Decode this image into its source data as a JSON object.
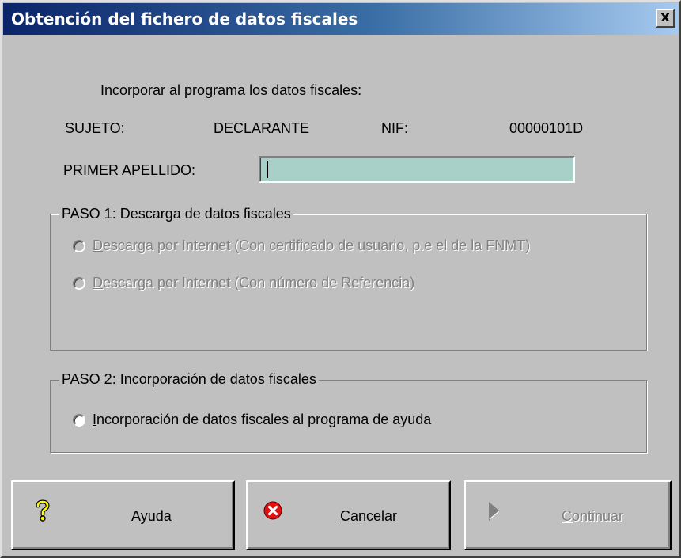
{
  "window": {
    "title": "Obtención del fichero de datos fiscales",
    "close_glyph": "x"
  },
  "intro": {
    "text": "Incorporar al programa los datos fiscales:"
  },
  "subject": {
    "sujeto_label": "SUJETO:",
    "sujeto_value": "DECLARANTE",
    "nif_label": "NIF:",
    "nif_value": "00000101D"
  },
  "apellido": {
    "label": "PRIMER APELLIDO:",
    "value": ""
  },
  "paso1": {
    "legend": "PASO 1: Descarga de datos fiscales",
    "options": [
      {
        "accel": "D",
        "rest": "escarga por Internet (Con certificado  de usuario, p.e el de la FNMT)",
        "enabled": false
      },
      {
        "accel": "D",
        "rest": "escarga por Internet (Con número de Referencia)",
        "enabled": false
      }
    ]
  },
  "paso2": {
    "legend": "PASO 2: Incorporación de datos fiscales",
    "options": [
      {
        "accel": "I",
        "rest": "ncorporación de datos fiscales al programa de ayuda",
        "enabled": true
      }
    ]
  },
  "buttons": {
    "help": {
      "accel": "A",
      "rest": "yuda",
      "icon": "question-mark-icon"
    },
    "cancel": {
      "accel": "C",
      "rest": "ancelar",
      "icon": "red-x-icon"
    },
    "continue": {
      "accel": "C",
      "rest": "ontinuar",
      "icon": "play-arrow-icon",
      "enabled": false
    }
  },
  "colors": {
    "face": "#c0c0c0",
    "title_start": "#0a246a",
    "title_end": "#a6caf0",
    "input_bg": "#a8d0c8"
  }
}
